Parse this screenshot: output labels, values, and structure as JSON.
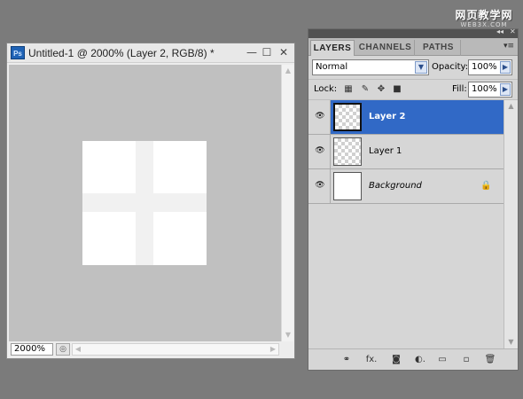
{
  "watermark": {
    "line1": "网页教学网",
    "line2": "WEB3X.COM"
  },
  "document": {
    "app_icon_label": "Ps",
    "title": "Untitled-1 @ 2000% (Layer 2, RGB/8) *",
    "window_controls": {
      "minimize": "—",
      "maximize": "☐",
      "close": "✕"
    },
    "zoom": "2000%",
    "canvas_color": "#c0c0c0",
    "image": {
      "background": "#ffffff",
      "cross_color": "#f1f1f1"
    }
  },
  "panel": {
    "tabs": [
      {
        "label": "LAYERS",
        "active": true
      },
      {
        "label": "CHANNELS",
        "active": false
      },
      {
        "label": "PATHS",
        "active": false
      }
    ],
    "menu_glyph": "▾≡",
    "collapse_glyph": "◂◂",
    "close_glyph": "✕",
    "blend_mode": "Normal",
    "opacity_label": "Opacity:",
    "opacity_value": "100%",
    "lock_label": "Lock:",
    "fill_label": "Fill:",
    "fill_value": "100%",
    "accent_color": "#3169c6",
    "layers": [
      {
        "name": "Layer 2",
        "selected": true,
        "visible": true,
        "thumbnail": "transparent",
        "locked": false
      },
      {
        "name": "Layer 1",
        "selected": false,
        "visible": true,
        "thumbnail": "transparent",
        "locked": false
      },
      {
        "name": "Background",
        "selected": false,
        "visible": true,
        "thumbnail": "white",
        "locked": true,
        "italic": true
      }
    ],
    "footer_icons": [
      "link-layers-icon",
      "fx-icon",
      "add-mask-icon",
      "adjustment-layer-icon",
      "new-group-icon",
      "new-layer-icon",
      "trash-icon"
    ],
    "footer_glyphs": {
      "link": "⚭",
      "fx": "fx.",
      "mask": "◙",
      "adjust": "◐.",
      "group": "▭",
      "new": "▫",
      "trash": "🗑"
    }
  }
}
